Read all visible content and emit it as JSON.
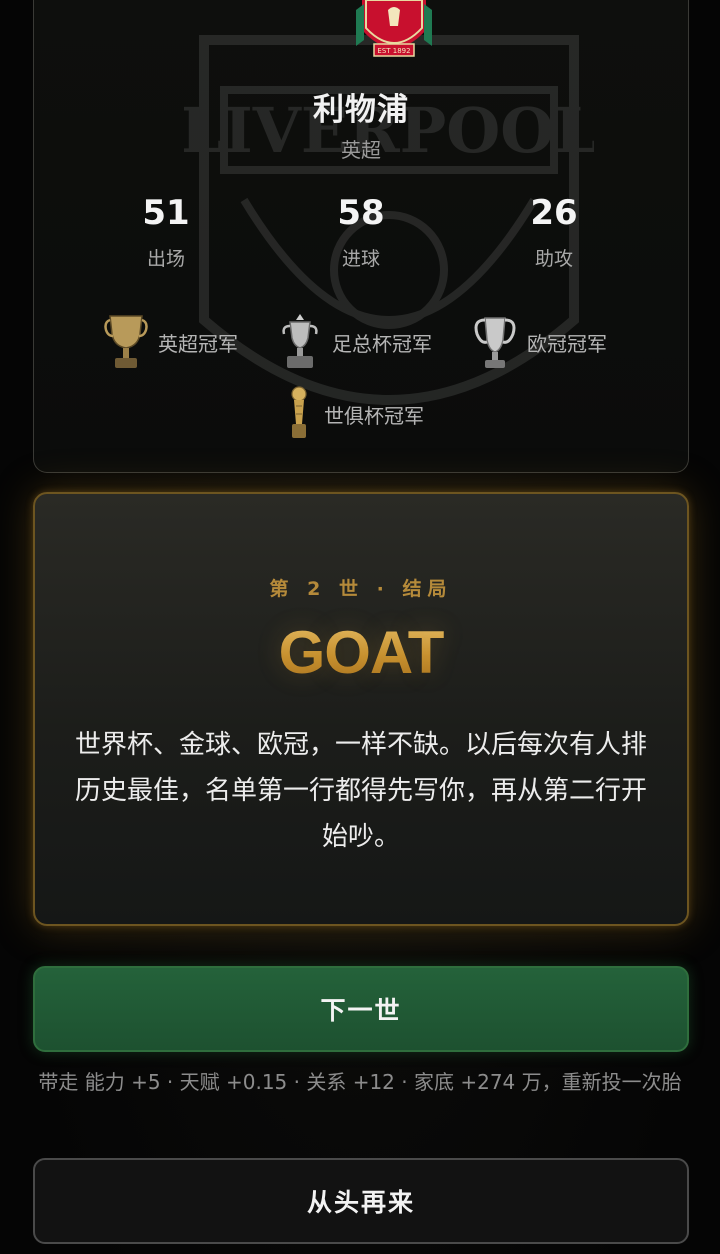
{
  "club": {
    "name": "利物浦",
    "league": "英超",
    "crest_icon": "liverpool-crest-icon",
    "watermark_icon": "liverpool-watermark-icon"
  },
  "stats": [
    {
      "value": "51",
      "label": "出场"
    },
    {
      "value": "58",
      "label": "进球"
    },
    {
      "value": "26",
      "label": "助攻"
    }
  ],
  "trophies": [
    {
      "label": "英超冠军",
      "icon": "premier-league-trophy-icon"
    },
    {
      "label": "足总杯冠军",
      "icon": "fa-cup-trophy-icon"
    },
    {
      "label": "欧冠冠军",
      "icon": "champions-league-trophy-icon"
    },
    {
      "label": "世俱杯冠军",
      "icon": "club-world-cup-trophy-icon"
    }
  ],
  "ending": {
    "kicker": "第 2 世 · 结局",
    "title": "GOAT",
    "text": "世界杯、金球、欧冠，一样不缺。以后每次有人排历史最佳，名单第一行都得先写你，再从第二行开始吵。",
    "accent_color": "#c8912f"
  },
  "actions": {
    "next_label": "下一世",
    "carry_note": "带走 能力 +5 · 天赋 +0.15 · 关系 +12 · 家底 +274 万，重新投一次胎",
    "restart_label": "从头再来",
    "next_color": "#24623a"
  }
}
